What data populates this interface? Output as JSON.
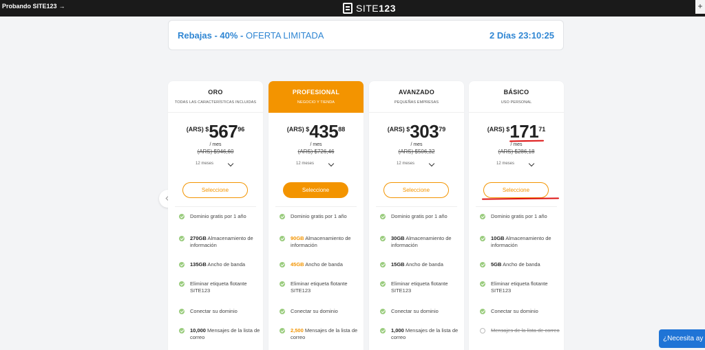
{
  "topbar": {
    "trial_label": "Probando SITE123",
    "trial_arrow": "→",
    "logo_light": "SITE",
    "logo_bold": "123",
    "plus": "+"
  },
  "promo": {
    "label_a": "Rebajas - ",
    "label_pct": "40% - ",
    "label_b": "OFERTA LIMITADA",
    "countdown": "2 Días 23:10:25"
  },
  "colors": {
    "accent": "#f39400",
    "blue": "#2f86d3",
    "check": "#9acc7e",
    "annotation": "#dd1111"
  },
  "plans": [
    {
      "name": "ORO",
      "subtitle": "TODAS LAS CARACTERÍSTICAS INCLUIDAS",
      "currency": "(ARS) $",
      "price_int": "567",
      "price_dec": "96",
      "per": "/ mes",
      "old_price": "(ARS) $946,60",
      "period": "12 meses",
      "button": "Seleccione",
      "f1": "Dominio gratis por 1 año",
      "f2_val": "270GB",
      "f2_txt": " Almacenamiento de información",
      "f3_val": "135GB",
      "f3_txt": " Ancho de banda",
      "f4": "Eliminar etiqueta flotante SITE123",
      "f5": "Conectar su dominio",
      "f6_val": "10,000",
      "f6_txt": " Mensajes de la lista de correo"
    },
    {
      "name": "PROFESIONAL",
      "subtitle": "NEGOCIO Y TIENDA",
      "currency": "(ARS) $",
      "price_int": "435",
      "price_dec": "88",
      "per": "/ mes",
      "old_price": "(ARS) $726,46",
      "period": "12 meses",
      "button": "Seleccione",
      "f1": "Dominio gratis por 1 año",
      "f2_val": "90GB",
      "f2_txt": " Almacenamiento de información",
      "f3_val": "45GB",
      "f3_txt": " Ancho de banda",
      "f4": "Eliminar etiqueta flotante SITE123",
      "f5": "Conectar su dominio",
      "f6_val": "2,500",
      "f6_txt": " Mensajes de la lista de correo"
    },
    {
      "name": "AVANZADO",
      "subtitle": "PEQUEÑAS EMPRESAS",
      "currency": "(ARS) $",
      "price_int": "303",
      "price_dec": "79",
      "per": "/ mes",
      "old_price": "(ARS) $506,32",
      "period": "12 meses",
      "button": "Seleccione",
      "f1": "Dominio gratis por 1 año",
      "f2_val": "30GB",
      "f2_txt": " Almacenamiento de información",
      "f3_val": "15GB",
      "f3_txt": " Ancho de banda",
      "f4": "Eliminar etiqueta flotante SITE123",
      "f5": "Conectar su dominio",
      "f6_val": "1,000",
      "f6_txt": " Mensajes de la lista de correo"
    },
    {
      "name": "BÁSICO",
      "subtitle": "USO PERSONAL",
      "currency": "(ARS) $",
      "price_int": "171",
      "price_dec": "71",
      "per": "/ mes",
      "old_price": "(ARS) $286,18",
      "period": "12 meses",
      "button": "Seleccione",
      "f1": "Dominio gratis por 1 año",
      "f2_val": "10GB",
      "f2_txt": " Almacenamiento de información",
      "f3_val": "5GB",
      "f3_txt": " Ancho de banda",
      "f4": "Eliminar etiqueta flotante SITE123",
      "f5": "Conectar su dominio",
      "f6_val": "",
      "f6_txt": "Mensajes de la lista de correo"
    }
  ],
  "help": {
    "label": "¿Necesita ay"
  }
}
